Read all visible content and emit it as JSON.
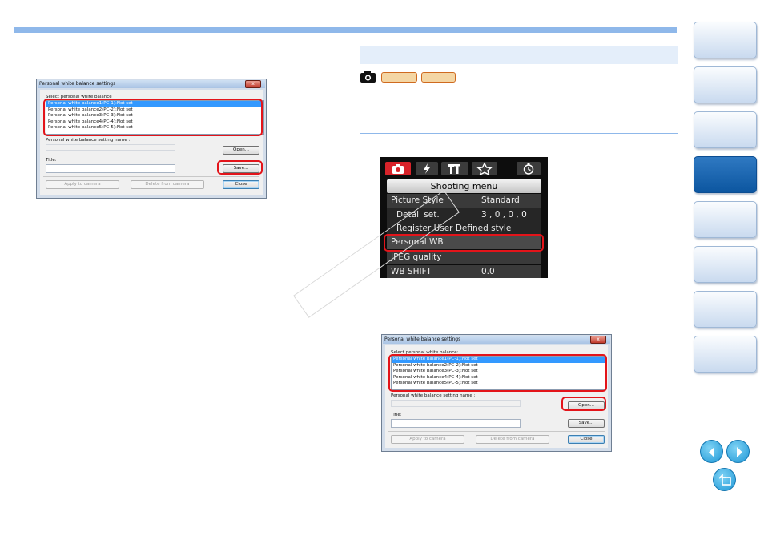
{
  "dialog": {
    "title": "Personal white balance settings",
    "close_glyph": "x",
    "select_label": "Select personal white balance",
    "items": [
      "Personal white balance1(PC-1):Not set",
      "Personal white balance2(PC-2):Not set",
      "Personal white balance3(PC-3):Not set",
      "Personal white balance4(PC-4):Not set",
      "Personal white balance5(PC-5):Not set"
    ],
    "name_label": "Personal white balance setting name :",
    "title_label": "Title:",
    "open_label": "Open...",
    "save_label": "Save...",
    "apply_label": "Apply to camera",
    "delete_label": "Delete from camera",
    "close_label": "Close"
  },
  "dialog2": {
    "select_label": "Select personal white balance:"
  },
  "lcd": {
    "header": "Shooting menu",
    "rows": [
      {
        "label": "Picture Style",
        "value": "Standard"
      },
      {
        "label": "Detail set.",
        "value": "3 , 0 , 0 , 0"
      },
      {
        "label": "Register User Defined style",
        "value": ""
      },
      {
        "label": "Personal WB",
        "value": ""
      },
      {
        "label": "JPEG quality",
        "value": ""
      },
      {
        "label": "WB SHIFT",
        "value": "0.0"
      }
    ]
  },
  "icons": {
    "camera": "camera-icon",
    "prev": "arrow-left-icon",
    "next": "arrow-right-icon",
    "back": "return-icon"
  },
  "colors": {
    "accent": "#8fb8ea",
    "highlight": "#e3141a",
    "active_nav": "#0c56a0"
  }
}
